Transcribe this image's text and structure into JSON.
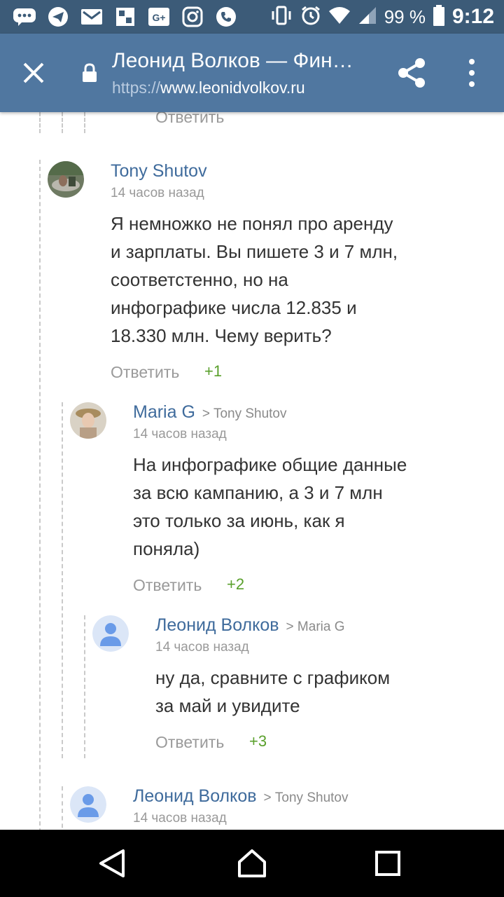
{
  "status_bar": {
    "left_icons": [
      "chat-icon",
      "telegram-icon",
      "mail-icon",
      "gallery-icon",
      "google-plus-icon",
      "instagram-icon",
      "phone-icon"
    ],
    "right_icons": [
      "vibrate-icon",
      "alarm-icon",
      "wifi-icon",
      "signal-icon",
      "battery-icon"
    ],
    "battery": "99 %",
    "time": "9:12"
  },
  "browser": {
    "page_title": "Леонид Волков — Фин…",
    "url_scheme": "https://",
    "url_host": "www.leonidvolkov.ru"
  },
  "top_fragment": {
    "reply_label": "Ответить"
  },
  "comments": [
    {
      "author": "Tony Shutov",
      "reply_to": "",
      "time": "14 часов назад",
      "text_lines": [
        "Я немножко не понял про аренду",
        "и зарплаты. Вы пишете 3 и 7 млн,",
        "соответстенно, но на",
        "инфографике числа 12.835 и",
        "18.330 млн. Чему верить?"
      ],
      "reply_label": "Ответить",
      "votes": "+1"
    },
    {
      "author": "Maria G",
      "reply_to": "> Tony Shutov",
      "time": "14 часов назад",
      "text_lines": [
        "На инфографике общие данные",
        "за всю кампанию, а 3 и 7 млн",
        "это только за июнь, как я",
        "поняла)"
      ],
      "reply_label": "Ответить",
      "votes": "+2"
    },
    {
      "author": "Леонид Волков",
      "reply_to": "> Maria G",
      "time": "14 часов назад",
      "text_lines": [
        "ну да, сравните с графиком",
        "за май и увидите"
      ],
      "reply_label": "Ответить",
      "votes": "+3"
    },
    {
      "author": "Леонид Волков",
      "reply_to": "> Tony Shutov",
      "time": "14 часов назад"
    }
  ],
  "colors": {
    "status_bar": "#3c5b78",
    "toolbar": "#5077a0",
    "author_link": "#3f6b9c",
    "votes": "#5aa02c",
    "default_avatar": "#6a9be8"
  }
}
